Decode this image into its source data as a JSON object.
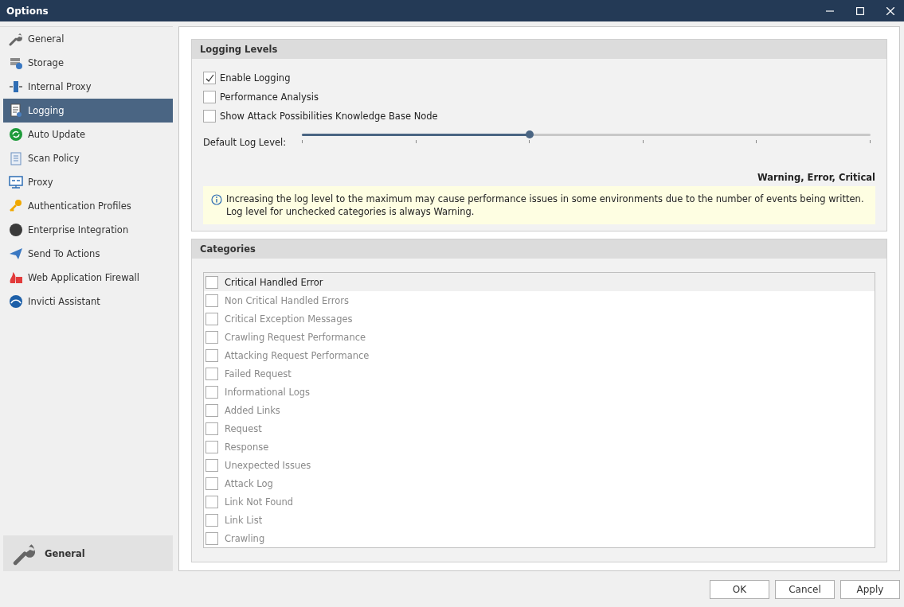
{
  "window": {
    "title": "Options"
  },
  "sidebar": {
    "items": [
      {
        "label": "General",
        "selected": false
      },
      {
        "label": "Storage",
        "selected": false
      },
      {
        "label": "Internal Proxy",
        "selected": false
      },
      {
        "label": "Logging",
        "selected": true
      },
      {
        "label": "Auto Update",
        "selected": false
      },
      {
        "label": "Scan Policy",
        "selected": false
      },
      {
        "label": "Proxy",
        "selected": false
      },
      {
        "label": "Authentication Profiles",
        "selected": false
      },
      {
        "label": "Enterprise Integration",
        "selected": false
      },
      {
        "label": "Send To Actions",
        "selected": false
      },
      {
        "label": "Web Application Firewall",
        "selected": false
      },
      {
        "label": "Invicti Assistant",
        "selected": false
      }
    ],
    "footer": {
      "label": "General"
    }
  },
  "logging_levels": {
    "title": "Logging Levels",
    "options": [
      {
        "label": "Enable Logging",
        "checked": true
      },
      {
        "label": "Performance Analysis",
        "checked": false
      },
      {
        "label": "Show Attack Possibilities Knowledge Base Node",
        "checked": false
      }
    ],
    "slider": {
      "label": "Default Log Level:",
      "level": 0.4,
      "reading": "Warning, Error, Critical"
    },
    "info": [
      "Increasing the log level to the maximum may cause performance issues in some environments due to the number of events being written.",
      "Log level for unchecked categories is always Warning."
    ]
  },
  "categories": {
    "title": "Categories",
    "items": [
      {
        "label": "Critical Handled Error",
        "checked": false,
        "selected": true,
        "disabled": false
      },
      {
        "label": "Non Critical Handled Errors",
        "checked": false,
        "selected": false,
        "disabled": true
      },
      {
        "label": "Critical Exception Messages",
        "checked": false,
        "selected": false,
        "disabled": true
      },
      {
        "label": "Crawling Request Performance",
        "checked": false,
        "selected": false,
        "disabled": true
      },
      {
        "label": "Attacking Request Performance",
        "checked": false,
        "selected": false,
        "disabled": true
      },
      {
        "label": "Failed Request",
        "checked": false,
        "selected": false,
        "disabled": true
      },
      {
        "label": "Informational Logs",
        "checked": false,
        "selected": false,
        "disabled": true
      },
      {
        "label": "Added Links",
        "checked": false,
        "selected": false,
        "disabled": true
      },
      {
        "label": "Request",
        "checked": false,
        "selected": false,
        "disabled": true
      },
      {
        "label": "Response",
        "checked": false,
        "selected": false,
        "disabled": true
      },
      {
        "label": "Unexpected Issues",
        "checked": false,
        "selected": false,
        "disabled": true
      },
      {
        "label": "Attack Log",
        "checked": false,
        "selected": false,
        "disabled": true
      },
      {
        "label": "Link Not Found",
        "checked": false,
        "selected": false,
        "disabled": true
      },
      {
        "label": "Link List",
        "checked": false,
        "selected": false,
        "disabled": true
      },
      {
        "label": "Crawling",
        "checked": false,
        "selected": false,
        "disabled": true
      }
    ]
  },
  "buttons": [
    "OK",
    "Cancel",
    "Apply"
  ]
}
